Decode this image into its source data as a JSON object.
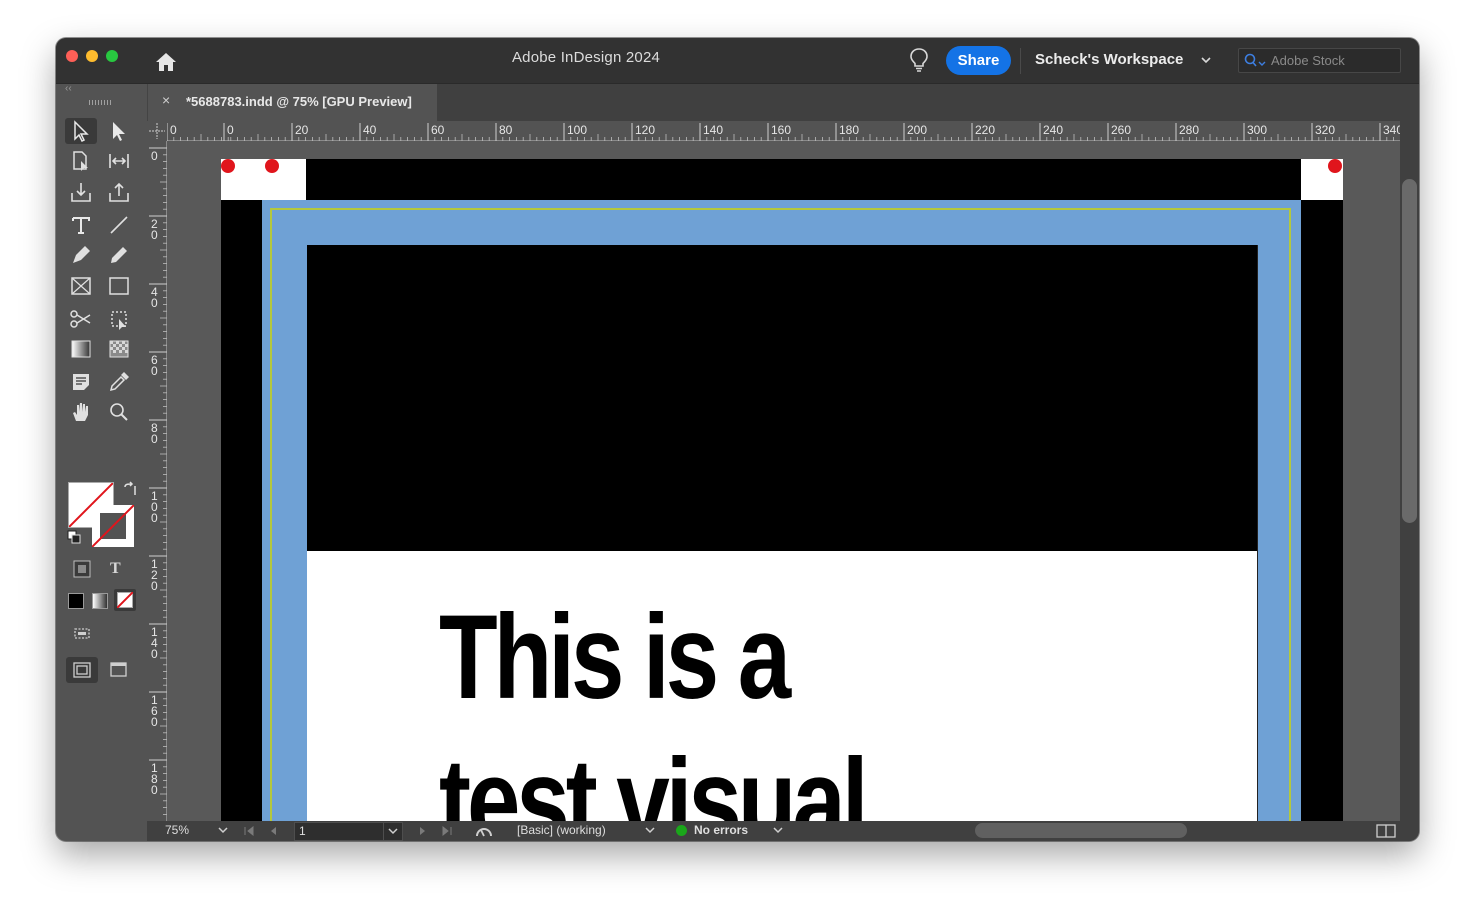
{
  "window": {
    "title": "Adobe InDesign 2024",
    "share_label": "Share",
    "workspace_label": "Scheck's Workspace",
    "search_placeholder": "Adobe Stock"
  },
  "document_tab": {
    "close_label": "×",
    "title": "*5688783.indd @ 75% [GPU Preview]"
  },
  "toolbox": {
    "tools": [
      "selection-tool",
      "direct-selection-tool",
      "page-tool",
      "gap-tool",
      "content-collector-tool",
      "content-placer-tool",
      "type-tool",
      "line-tool",
      "pen-tool",
      "pencil-tool",
      "rectangle-frame-tool",
      "rectangle-tool",
      "scissors-tool",
      "free-transform-tool",
      "gradient-swatch-tool",
      "gradient-feather-tool",
      "note-tool",
      "eyedropper-tool",
      "hand-tool",
      "zoom-tool"
    ],
    "apply_mode_labels": {
      "text": "T"
    }
  },
  "rulers": {
    "horizontal_ticks": [
      "0",
      "0",
      "20",
      "40",
      "60",
      "80",
      "100",
      "120",
      "140",
      "160",
      "180",
      "200",
      "220",
      "240",
      "260",
      "280",
      "300",
      "320",
      "340"
    ],
    "vertical_ticks": [
      "0",
      "20",
      "40",
      "60",
      "80",
      "100",
      "120",
      "140",
      "160",
      "180"
    ]
  },
  "page": {
    "body_text_line1": "This is a",
    "body_text_line2": "test visual.",
    "colors": {
      "bleed": "#000000",
      "frame": "#6fa1d5",
      "margin_guide": "#b4c83c",
      "image_block": "#000000",
      "paper": "#ffffff",
      "marker": "#e0151c"
    }
  },
  "status": {
    "zoom": "75%",
    "page_number": "1",
    "preflight_profile": "[Basic] (working)",
    "preflight_status": "No errors",
    "preflight_status_color": "#1aa71a"
  }
}
